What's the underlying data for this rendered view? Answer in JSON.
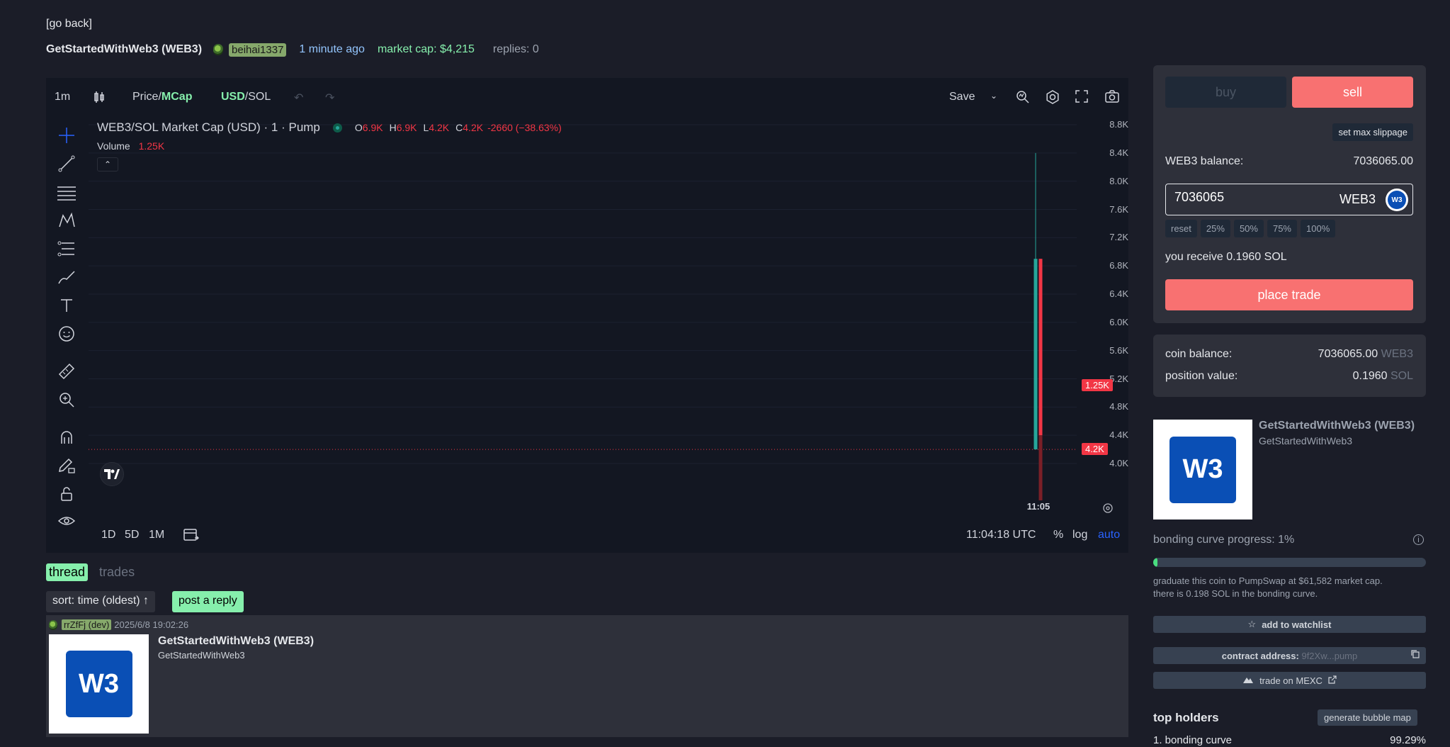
{
  "nav": {
    "go_back": "[go back]"
  },
  "header": {
    "token_title": "GetStartedWithWeb3 (WEB3)",
    "creator": "beihai1337",
    "time_ago": "1 minute ago",
    "market_cap": "market cap: $4,215",
    "replies": "replies: 0"
  },
  "chart_toolbar": {
    "interval": "1m",
    "price_label": "Price",
    "mcap_label": "MCap",
    "usd_label": "USD",
    "sol_label": "SOL",
    "save_label": "Save"
  },
  "chart_legend": {
    "symbol": "WEB3/SOL Market Cap (USD) · 1 · Pump",
    "o_label": "O",
    "o_value": "6.9K",
    "h_label": "H",
    "h_value": "6.9K",
    "l_label": "L",
    "l_value": "4.2K",
    "c_label": "C",
    "c_value": "4.2K",
    "change": "-2660 (−38.63%)",
    "volume_label": "Volume",
    "volume_value": "1.25K"
  },
  "chart_bottom": {
    "ranges": [
      "1D",
      "5D",
      "1M"
    ],
    "time_utc": "11:04:18 UTC",
    "pct": "%",
    "log": "log",
    "auto": "auto"
  },
  "chart_data": {
    "type": "candlestick",
    "yticks": [
      "8.8K",
      "8.4K",
      "8.0K",
      "7.6K",
      "7.2K",
      "6.8K",
      "6.4K",
      "6.0K",
      "5.6K",
      "5.2K",
      "4.8K",
      "4.4K",
      "4.0K"
    ],
    "ylim": [
      4000,
      8800
    ],
    "xtick": "11:05",
    "candles": [
      {
        "open": 4200,
        "high": 8400,
        "low": 4200,
        "close": 6900,
        "color": "#26a69a"
      },
      {
        "open": 6900,
        "high": 6900,
        "low": 4200,
        "close": 4200,
        "color": "#f23645"
      }
    ],
    "volume_bar": {
      "value": "1.25K",
      "color": "#f23645"
    },
    "price_marker": "4.2K",
    "volume_marker": "1.25K"
  },
  "thread": {
    "tab_thread": "thread",
    "tab_trades": "trades",
    "sort_label": "sort: time (oldest) ↑",
    "reply_label": "post a reply",
    "post": {
      "user": "rrZfFj (dev)",
      "timestamp": "2025/6/8 19:02:26",
      "title": "GetStartedWithWeb3 (WEB3)",
      "subtitle": "GetStartedWithWeb3"
    }
  },
  "trade": {
    "buy_label": "buy",
    "sell_label": "sell",
    "slippage_label": "set max slippage",
    "balance_label": "WEB3 balance:",
    "balance_value": "7036065.00",
    "amount_value": "7036065",
    "amount_unit": "WEB3",
    "pct_options": [
      "reset",
      "25%",
      "50%",
      "75%",
      "100%"
    ],
    "receive_text": "you receive 0.1960 SOL",
    "place_label": "place trade"
  },
  "coin_stats": {
    "balance_label": "coin balance:",
    "balance_value": "7036065.00",
    "balance_unit": "WEB3",
    "position_label": "position value:",
    "position_value": "0.1960",
    "position_unit": "SOL"
  },
  "coin_info": {
    "title": "GetStartedWithWeb3 (WEB3)",
    "subtitle": "GetStartedWithWeb3",
    "logo_text": "W3"
  },
  "bonding": {
    "label": "bonding curve progress: 1%",
    "progress_pct": 1,
    "graduate_text": "graduate this coin to PumpSwap at $61,582 market cap.",
    "sol_text": "there is 0.198 SOL in the bonding curve."
  },
  "actions": {
    "watchlist": "add to watchlist",
    "contract_label": "contract address:",
    "contract_value": "9f2Xw...pump",
    "mexc": "trade on MEXC"
  },
  "holders": {
    "title": "top holders",
    "bubble_label": "generate bubble map",
    "rows": [
      {
        "name": "1. bonding curve",
        "pct": "99.29%"
      }
    ]
  },
  "colors": {
    "accent_green": "#86efac",
    "accent_red": "#f87171",
    "bg": "#1b1d28",
    "panel": "#2e303a"
  }
}
